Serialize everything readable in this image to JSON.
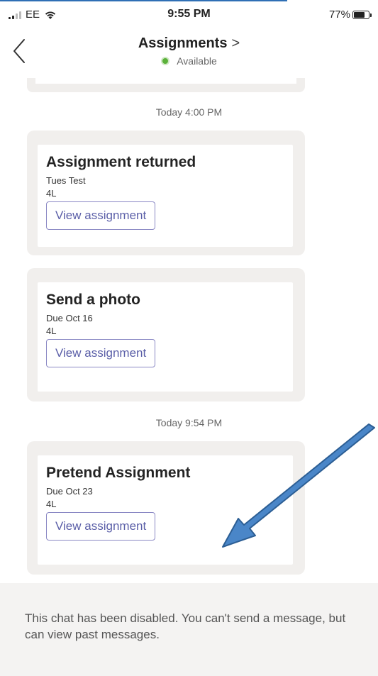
{
  "status_bar": {
    "carrier": "EE",
    "time": "9:55 PM",
    "battery": "77%",
    "battery_level": 0.77
  },
  "header": {
    "title": "Assignments",
    "title_chevron": ">",
    "presence": "Available"
  },
  "messages": [
    {
      "timestamp": "Today 4:00 PM"
    },
    {
      "timestamp": "Today 9:54 PM"
    }
  ],
  "cards": [
    {
      "title": "Assignment returned",
      "subtitle": "Tues Test",
      "class": "4L",
      "button": "View assignment"
    },
    {
      "title": "Send a photo",
      "subtitle": "Due Oct 16",
      "class": "4L",
      "button": "View assignment"
    },
    {
      "title": "Pretend Assignment",
      "subtitle": "Due Oct 23",
      "class": "4L",
      "button": "View assignment"
    }
  ],
  "footer": {
    "text": "This chat has been disabled. You can't send a message, but can view past messages."
  },
  "colors": {
    "accent": "#5b5fa8",
    "presence": "#5bb13a",
    "annotation_arrow": "#4a86c8"
  },
  "icons": [
    "back-chevron-icon",
    "cellular-signal-icon",
    "wifi-icon",
    "battery-icon",
    "presence-dot-icon"
  ]
}
